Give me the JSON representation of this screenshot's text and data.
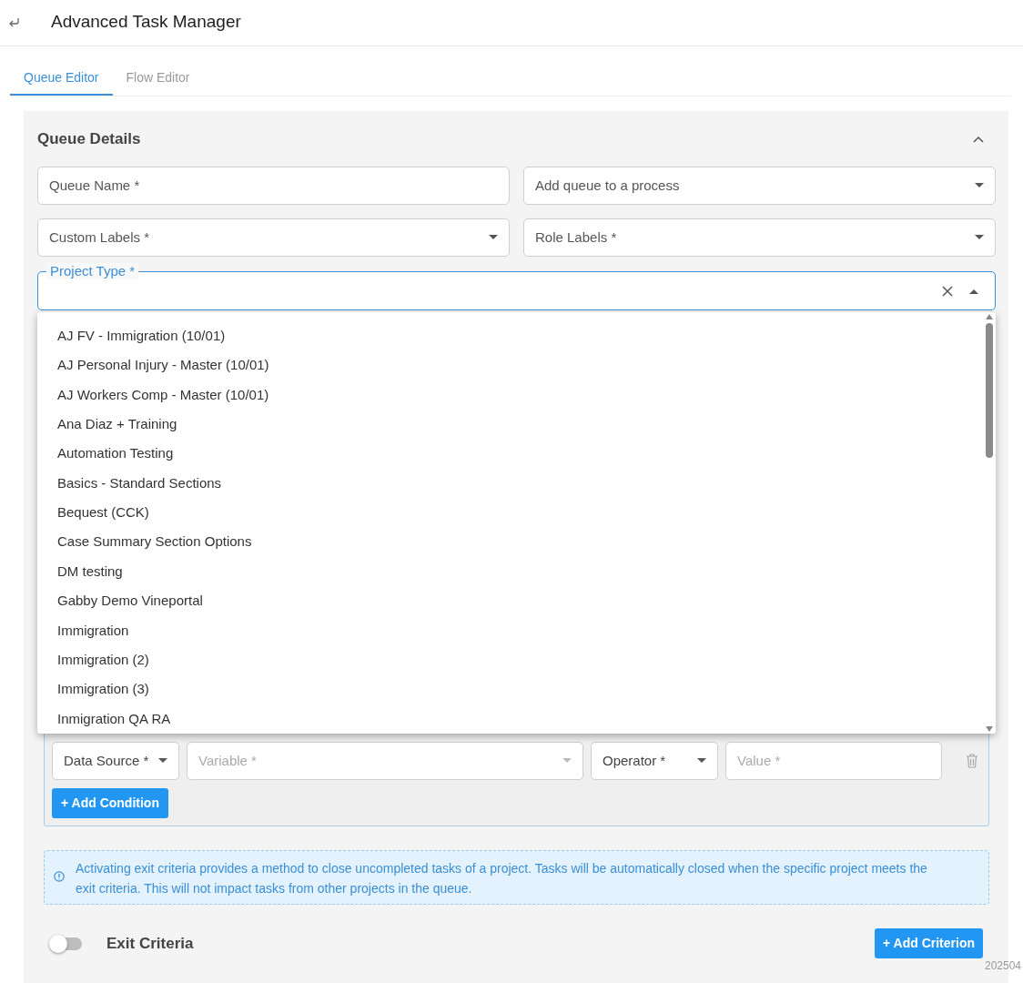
{
  "header": {
    "title": "Advanced Task Manager"
  },
  "tabs": [
    {
      "label": "Queue Editor",
      "selected": true
    },
    {
      "label": "Flow Editor",
      "selected": false
    }
  ],
  "queue_details": {
    "title": "Queue Details",
    "expanded": true,
    "fields": [
      {
        "kind": "text",
        "placeholder": "Queue Name *"
      },
      {
        "kind": "select",
        "placeholder": "Add queue to a process"
      },
      {
        "kind": "select",
        "placeholder": "Custom Labels *"
      },
      {
        "kind": "select",
        "placeholder": "Role Labels *"
      }
    ],
    "project_type": {
      "label": "Project Type *",
      "expanded": true,
      "options": [
        "AJ FV - Immigration (10/01)",
        "AJ Personal Injury - Master (10/01)",
        "AJ Workers Comp - Master (10/01)",
        "Ana Diaz + Training",
        "Automation Testing",
        "Basics - Standard Sections",
        "Bequest (CCK)",
        "Case Summary Section Options",
        "DM testing",
        "Gabby Demo Vineportal",
        "Immigration",
        "Immigration (2)",
        "Immigration (3)",
        "Inmigration QA RA"
      ]
    }
  },
  "condition": {
    "fields": [
      {
        "placeholder": "Data Source *",
        "disabled": false,
        "kind": "select"
      },
      {
        "placeholder": "Variable *",
        "disabled": true,
        "kind": "select"
      },
      {
        "placeholder": "Operator *",
        "disabled": false,
        "kind": "select"
      },
      {
        "placeholder": "Value *",
        "disabled": true,
        "kind": "text"
      }
    ],
    "add_button": "+ Add Condition"
  },
  "info": "Activating exit criteria provides a method to close uncompleted tasks of a project. Tasks will be automatically closed when the specific project meets the exit criteria. This will not impact tasks from other projects in the queue.",
  "exit_criteria": {
    "label": "Exit Criteria",
    "on": false,
    "add_button": "+ Add Criterion"
  },
  "footer_text": "202504"
}
